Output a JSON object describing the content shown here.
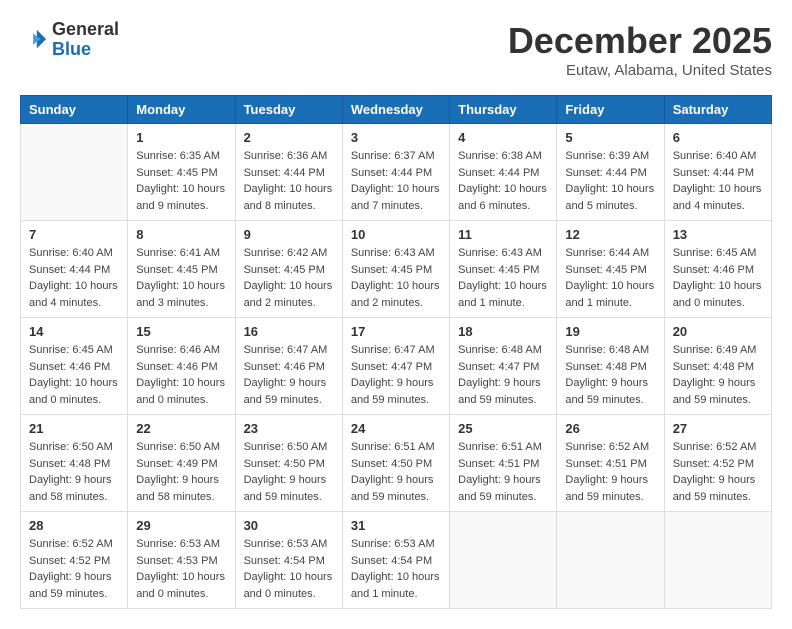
{
  "header": {
    "logo_line1": "General",
    "logo_line2": "Blue",
    "month_title": "December 2025",
    "location": "Eutaw, Alabama, United States"
  },
  "weekdays": [
    "Sunday",
    "Monday",
    "Tuesday",
    "Wednesday",
    "Thursday",
    "Friday",
    "Saturday"
  ],
  "weeks": [
    [
      {
        "day": "",
        "sunrise": "",
        "sunset": "",
        "daylight": ""
      },
      {
        "day": "1",
        "sunrise": "Sunrise: 6:35 AM",
        "sunset": "Sunset: 4:45 PM",
        "daylight": "Daylight: 10 hours and 9 minutes."
      },
      {
        "day": "2",
        "sunrise": "Sunrise: 6:36 AM",
        "sunset": "Sunset: 4:44 PM",
        "daylight": "Daylight: 10 hours and 8 minutes."
      },
      {
        "day": "3",
        "sunrise": "Sunrise: 6:37 AM",
        "sunset": "Sunset: 4:44 PM",
        "daylight": "Daylight: 10 hours and 7 minutes."
      },
      {
        "day": "4",
        "sunrise": "Sunrise: 6:38 AM",
        "sunset": "Sunset: 4:44 PM",
        "daylight": "Daylight: 10 hours and 6 minutes."
      },
      {
        "day": "5",
        "sunrise": "Sunrise: 6:39 AM",
        "sunset": "Sunset: 4:44 PM",
        "daylight": "Daylight: 10 hours and 5 minutes."
      },
      {
        "day": "6",
        "sunrise": "Sunrise: 6:40 AM",
        "sunset": "Sunset: 4:44 PM",
        "daylight": "Daylight: 10 hours and 4 minutes."
      }
    ],
    [
      {
        "day": "7",
        "sunrise": "Sunrise: 6:40 AM",
        "sunset": "Sunset: 4:44 PM",
        "daylight": "Daylight: 10 hours and 4 minutes."
      },
      {
        "day": "8",
        "sunrise": "Sunrise: 6:41 AM",
        "sunset": "Sunset: 4:45 PM",
        "daylight": "Daylight: 10 hours and 3 minutes."
      },
      {
        "day": "9",
        "sunrise": "Sunrise: 6:42 AM",
        "sunset": "Sunset: 4:45 PM",
        "daylight": "Daylight: 10 hours and 2 minutes."
      },
      {
        "day": "10",
        "sunrise": "Sunrise: 6:43 AM",
        "sunset": "Sunset: 4:45 PM",
        "daylight": "Daylight: 10 hours and 2 minutes."
      },
      {
        "day": "11",
        "sunrise": "Sunrise: 6:43 AM",
        "sunset": "Sunset: 4:45 PM",
        "daylight": "Daylight: 10 hours and 1 minute."
      },
      {
        "day": "12",
        "sunrise": "Sunrise: 6:44 AM",
        "sunset": "Sunset: 4:45 PM",
        "daylight": "Daylight: 10 hours and 1 minute."
      },
      {
        "day": "13",
        "sunrise": "Sunrise: 6:45 AM",
        "sunset": "Sunset: 4:46 PM",
        "daylight": "Daylight: 10 hours and 0 minutes."
      }
    ],
    [
      {
        "day": "14",
        "sunrise": "Sunrise: 6:45 AM",
        "sunset": "Sunset: 4:46 PM",
        "daylight": "Daylight: 10 hours and 0 minutes."
      },
      {
        "day": "15",
        "sunrise": "Sunrise: 6:46 AM",
        "sunset": "Sunset: 4:46 PM",
        "daylight": "Daylight: 10 hours and 0 minutes."
      },
      {
        "day": "16",
        "sunrise": "Sunrise: 6:47 AM",
        "sunset": "Sunset: 4:46 PM",
        "daylight": "Daylight: 9 hours and 59 minutes."
      },
      {
        "day": "17",
        "sunrise": "Sunrise: 6:47 AM",
        "sunset": "Sunset: 4:47 PM",
        "daylight": "Daylight: 9 hours and 59 minutes."
      },
      {
        "day": "18",
        "sunrise": "Sunrise: 6:48 AM",
        "sunset": "Sunset: 4:47 PM",
        "daylight": "Daylight: 9 hours and 59 minutes."
      },
      {
        "day": "19",
        "sunrise": "Sunrise: 6:48 AM",
        "sunset": "Sunset: 4:48 PM",
        "daylight": "Daylight: 9 hours and 59 minutes."
      },
      {
        "day": "20",
        "sunrise": "Sunrise: 6:49 AM",
        "sunset": "Sunset: 4:48 PM",
        "daylight": "Daylight: 9 hours and 59 minutes."
      }
    ],
    [
      {
        "day": "21",
        "sunrise": "Sunrise: 6:50 AM",
        "sunset": "Sunset: 4:48 PM",
        "daylight": "Daylight: 9 hours and 58 minutes."
      },
      {
        "day": "22",
        "sunrise": "Sunrise: 6:50 AM",
        "sunset": "Sunset: 4:49 PM",
        "daylight": "Daylight: 9 hours and 58 minutes."
      },
      {
        "day": "23",
        "sunrise": "Sunrise: 6:50 AM",
        "sunset": "Sunset: 4:50 PM",
        "daylight": "Daylight: 9 hours and 59 minutes."
      },
      {
        "day": "24",
        "sunrise": "Sunrise: 6:51 AM",
        "sunset": "Sunset: 4:50 PM",
        "daylight": "Daylight: 9 hours and 59 minutes."
      },
      {
        "day": "25",
        "sunrise": "Sunrise: 6:51 AM",
        "sunset": "Sunset: 4:51 PM",
        "daylight": "Daylight: 9 hours and 59 minutes."
      },
      {
        "day": "26",
        "sunrise": "Sunrise: 6:52 AM",
        "sunset": "Sunset: 4:51 PM",
        "daylight": "Daylight: 9 hours and 59 minutes."
      },
      {
        "day": "27",
        "sunrise": "Sunrise: 6:52 AM",
        "sunset": "Sunset: 4:52 PM",
        "daylight": "Daylight: 9 hours and 59 minutes."
      }
    ],
    [
      {
        "day": "28",
        "sunrise": "Sunrise: 6:52 AM",
        "sunset": "Sunset: 4:52 PM",
        "daylight": "Daylight: 9 hours and 59 minutes."
      },
      {
        "day": "29",
        "sunrise": "Sunrise: 6:53 AM",
        "sunset": "Sunset: 4:53 PM",
        "daylight": "Daylight: 10 hours and 0 minutes."
      },
      {
        "day": "30",
        "sunrise": "Sunrise: 6:53 AM",
        "sunset": "Sunset: 4:54 PM",
        "daylight": "Daylight: 10 hours and 0 minutes."
      },
      {
        "day": "31",
        "sunrise": "Sunrise: 6:53 AM",
        "sunset": "Sunset: 4:54 PM",
        "daylight": "Daylight: 10 hours and 1 minute."
      },
      {
        "day": "",
        "sunrise": "",
        "sunset": "",
        "daylight": ""
      },
      {
        "day": "",
        "sunrise": "",
        "sunset": "",
        "daylight": ""
      },
      {
        "day": "",
        "sunrise": "",
        "sunset": "",
        "daylight": ""
      }
    ]
  ]
}
